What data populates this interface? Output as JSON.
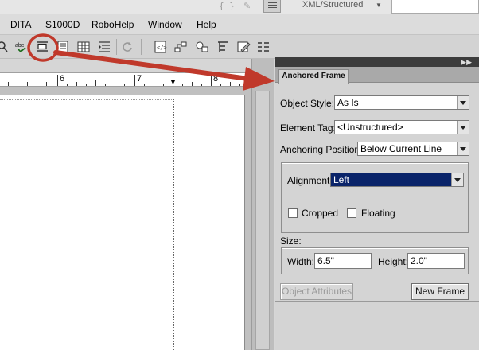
{
  "topbar": {
    "braces_glyph": "{ }",
    "workspace": "XML/Structured"
  },
  "menubar": {
    "items": [
      "DITA",
      "S1000D",
      "RoboHelp",
      "Window",
      "Help"
    ]
  },
  "toolbar": {
    "buttons": [
      "search-icon",
      "spell-check-icon",
      "anchored-frame-icon",
      "text-block-icon",
      "table-icon",
      "indent-text-icon",
      "refresh-icon",
      "code-view-icon",
      "structure-icon",
      "element-icon",
      "tag-icon",
      "edit-icon",
      "table-layout-icon"
    ],
    "spell_check_text": "abc"
  },
  "ruler": {
    "labels": [
      "6",
      "7",
      "8"
    ]
  },
  "panel": {
    "tab_label": "Anchored Frame",
    "object_style_label": "Object Style:",
    "object_style_value": "As Is",
    "element_tag_label": "Element Tag:",
    "element_tag_value": "<Unstructured>",
    "anchoring_position_label": "Anchoring Position:",
    "anchoring_position_value": "Below Current Line",
    "alignment_label": "Alignment:",
    "alignment_value": "Left",
    "cropped_label": "Cropped",
    "cropped_checked": false,
    "floating_label": "Floating",
    "floating_checked": false,
    "size_label": "Size:",
    "width_label": "Width:",
    "width_value": "6.5\"",
    "height_label": "Height:",
    "height_value": "2.0\"",
    "object_attributes_button": "Object Attributes",
    "new_frame_button": "New Frame"
  },
  "colors": {
    "annotation_red": "#c0392b",
    "selection_blue": "#0a246a"
  }
}
